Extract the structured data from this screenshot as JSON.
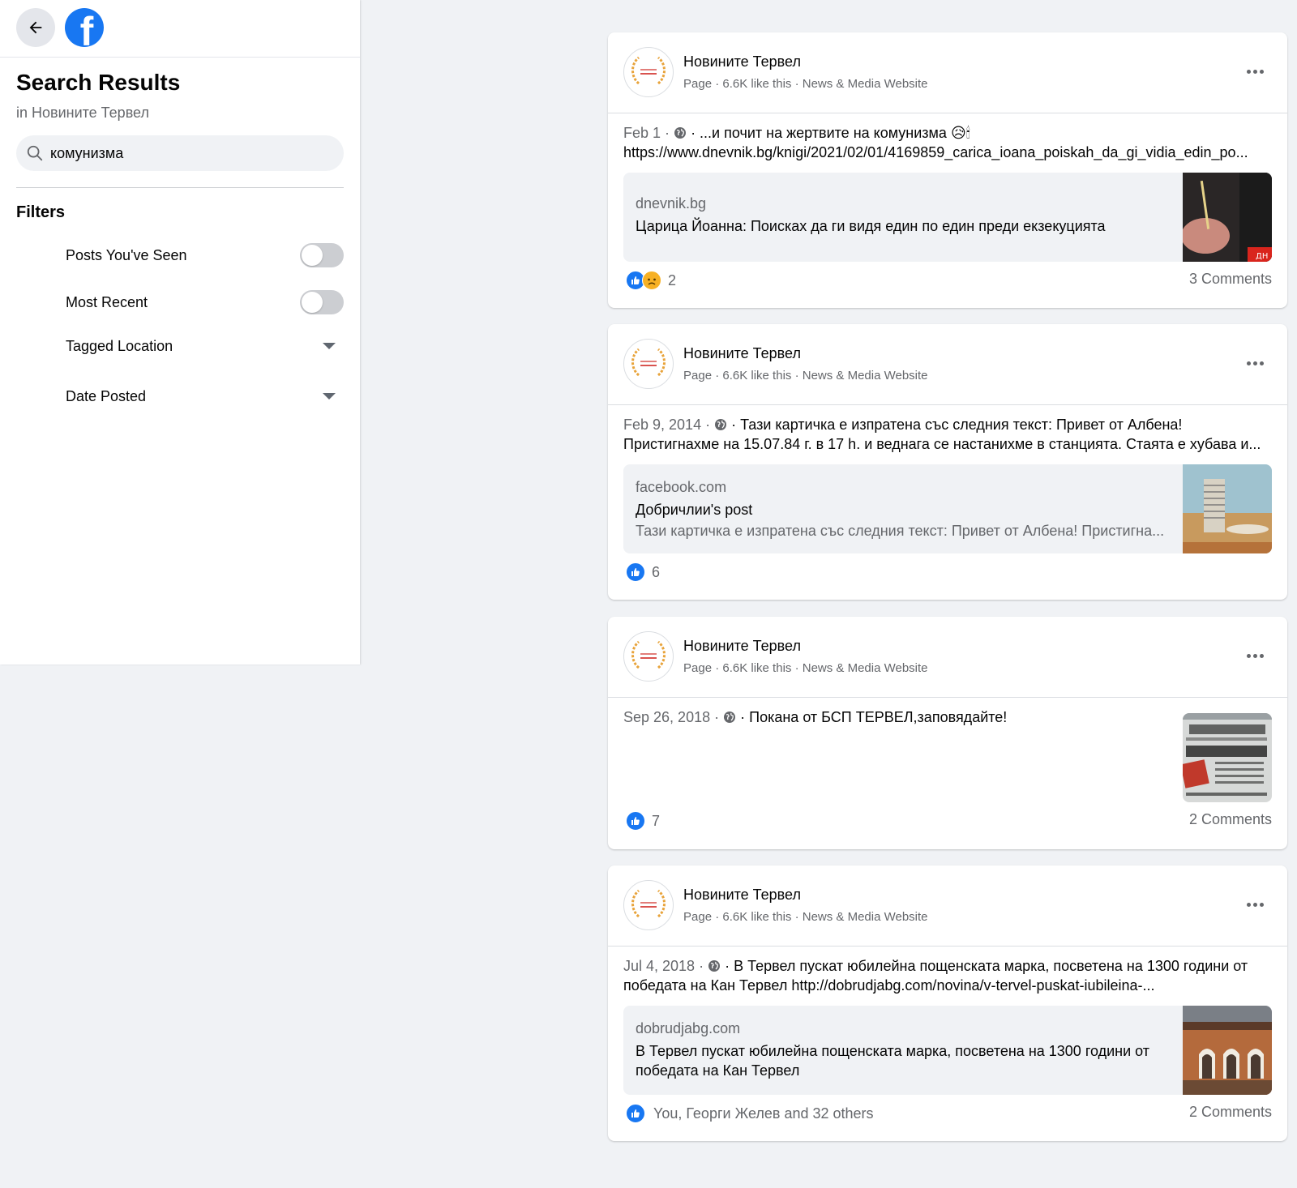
{
  "sidebar": {
    "title": "Search Results",
    "subtitle": "in Новините Тервел",
    "search_value": "комунизма",
    "filters_label": "Filters",
    "filters": {
      "posts_seen": "Posts You've Seen",
      "most_recent": "Most Recent",
      "tagged_location": "Tagged Location",
      "date_posted": "Date Posted"
    },
    "logo_letter": "f"
  },
  "colors": {
    "brand": "#1877f2",
    "background": "#f0f2f5",
    "meta_text": "#65676b"
  },
  "posts": [
    {
      "page_name": "Новините Тервел",
      "page_meta": "Page · 6.6K like this · News & Media Website",
      "date": "Feb 1",
      "text_line1": "· ...и почит на жертвите на комунизма 😥🕯",
      "text_line2": "https://www.dnevnik.bg/knigi/2021/02/01/4169859_carica_ioana_poiskah_da_gi_vidia_edin_po...",
      "link_domain": "dnevnik.bg",
      "link_title": "Царица Йоанна: Поисках да ги видя един по един преди екзекуцията",
      "reactions_count": "2",
      "comments": "3 Comments"
    },
    {
      "page_name": "Новините Тервел",
      "page_meta": "Page · 6.6K like this · News & Media Website",
      "date": "Feb 9, 2014",
      "text_line1": "· Тази картичка е изпратена със следния текст: Привет от Албена!",
      "text_line2": "Пристигнахме на 15.07.84 г. в 17 h. и веднага се настанихме в станцията. Стаята е хубава и...",
      "link_domain": "facebook.com",
      "link_title": "Добричлии's post",
      "link_desc": "Тази картичка е изпратена със следния текст: Привет от Албена! Пристигна...",
      "reactions_count": "6"
    },
    {
      "page_name": "Новините Тервел",
      "page_meta": "Page · 6.6K like this · News & Media Website",
      "date": "Sep 26, 2018",
      "text_line1": "· Покана от БСП ТЕРВЕЛ,заповядайте!",
      "reactions_count": "7",
      "comments": "2 Comments"
    },
    {
      "page_name": "Новините Тервел",
      "page_meta": "Page · 6.6K like this · News & Media Website",
      "date": "Jul 4, 2018",
      "text_line1": "· В Тервел пускат юбилейна пощенската марка, посветена на 1300 години от",
      "text_line2": "победата на Кан Тервел http://dobrudjabg.com/novina/v-tervel-puskat-iubileina-...",
      "link_domain": "dobrudjabg.com",
      "link_title": "В Тервел пускат юбилейна пощенската марка, посветена на 1300 години от победата на Кан Тервел",
      "reactions_text": "You, Георги Желев and 32 others",
      "comments": "2 Comments"
    }
  ]
}
